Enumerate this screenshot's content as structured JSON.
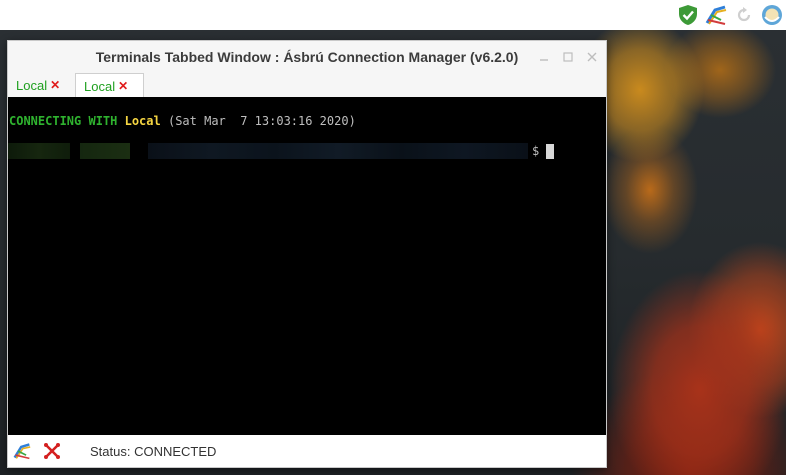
{
  "window": {
    "title": "Terminals Tabbed Window : Ásbrú Connection Manager (v6.2.0)"
  },
  "tabs": [
    {
      "label": "Local",
      "active": false
    },
    {
      "label": "Local",
      "active": true
    }
  ],
  "terminal": {
    "connecting_prefix": "CONNECTING WITH",
    "host": "Local",
    "timestamp": "(Sat Mar  7 13:03:16 2020)",
    "prompt_symbol": "$"
  },
  "status": {
    "text": "Status: CONNECTED"
  },
  "tray": {
    "icons": [
      "shield-check-icon",
      "asbru-app-icon",
      "refresh-icon",
      "user-avatar-icon"
    ]
  },
  "colors": {
    "tab_text": "#20a020",
    "tab_close": "#e01b1b",
    "terminal_bg": "#000000",
    "terminal_green": "#2fb32f",
    "terminal_yellow": "#f5d542"
  }
}
